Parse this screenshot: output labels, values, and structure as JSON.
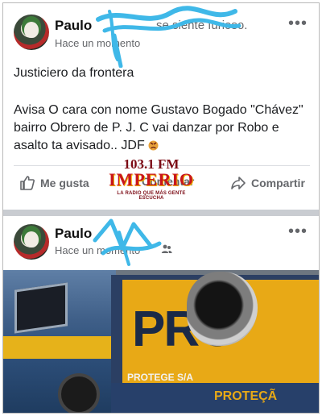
{
  "post1": {
    "author": "Paulo",
    "feeling": "se siente furioso.",
    "timestamp": "Hace un momento",
    "more": "•••",
    "title": "Justiciero da frontera",
    "body": "Avisa O cara con nome Gustavo Bogado \"Chávez\" bairro Obrero  de P. J. C vai danzar por Robo e asalto ta avisado.. JDF",
    "actions": {
      "like": "Me gusta",
      "comment": "Comentar",
      "share": "Compartir"
    }
  },
  "watermark": {
    "frequency": "103.1 FM",
    "station": "IMPERIO",
    "tagline": "LA RADIO QUE MÁS GENTE ESCUCHA"
  },
  "post2": {
    "author": "Paulo",
    "timestamp": "Hace un momento",
    "more": "•••",
    "photo_text": {
      "sign": "PRO",
      "company": "PROTEGE S/A",
      "band": "PROTEÇÃ"
    }
  },
  "colors": {
    "scribble": "#3fb8e8",
    "separator": "#c9ccd1"
  }
}
